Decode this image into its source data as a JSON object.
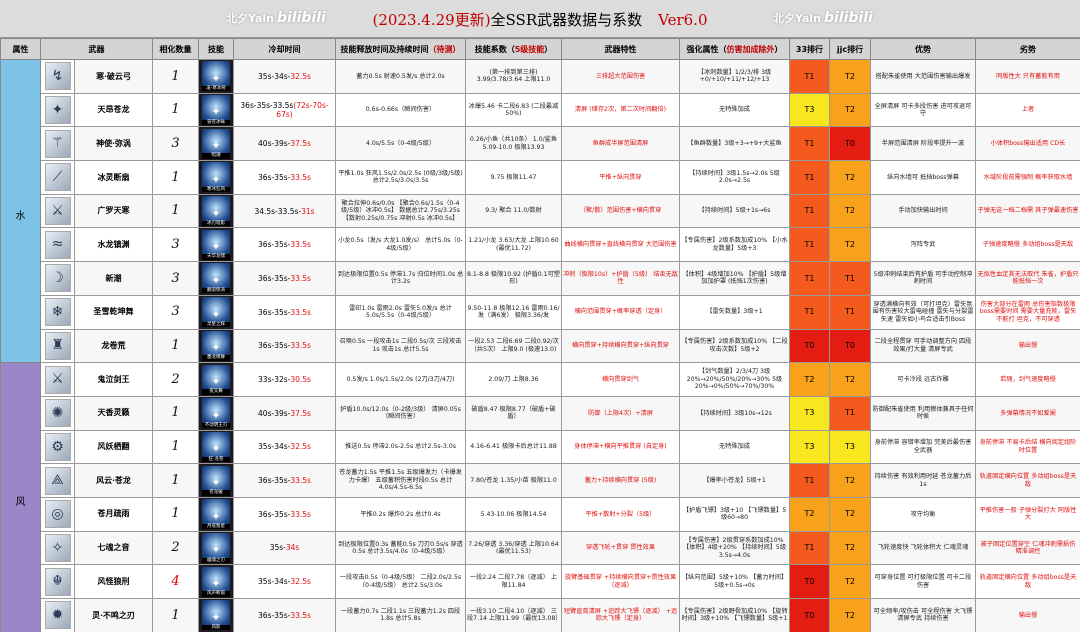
{
  "header": {
    "watermark_left": "北夕Yaln",
    "watermark_left_logo": "bilibili",
    "watermark_right": "北夕Yaln",
    "watermark_right_logo": "bilibili",
    "date": "(2023.4.29更新)",
    "title": "全SSR武器数据与系数",
    "version": "Ver6.0"
  },
  "columns": {
    "attr": "属性",
    "weapon": "武器",
    "count": "相化数量",
    "skill": "技能",
    "cooldown": "冷却时间",
    "release": "技能释放时间及持续时间",
    "release_note": "（待测）",
    "coef": "技能系数（",
    "coef_note": "5级技能",
    "coef_end": "）",
    "feature": "武器特性",
    "boost": "强化属性（",
    "boost_note": "仿害加成除外",
    "boost_end": "）",
    "r33": "33排行",
    "jjc": "jjc排行",
    "pros": "优势",
    "cons": "劣势"
  },
  "attributes": {
    "water": "水",
    "wind": "风"
  },
  "rows": [
    {
      "name": "寒·破云弓",
      "count": "1",
      "skill": "凌·寒冰射",
      "cd": "35s-34s-",
      "cd_hl": "32.5s",
      "release": "蓄力0.5s 射速0.5发/s 总计2.0s",
      "coef": "(第一排到第三排) 3.99/3.78/3.64 上限11.0",
      "feature": "三排超大范围伤害",
      "boost": "【冰刺数量】1/2/3/排 3级+0/+10/+11/+12/+13",
      "r33": "T1",
      "r33_cls": "t1",
      "jjc": "T2",
      "jjc_cls": "t2",
      "pros": "搭配朱雀使用 大范围伤害输出爆发",
      "cons": "同版性大 只有蓄能有用",
      "icon": "↯"
    },
    {
      "name": "天昂苍龙",
      "count": "1",
      "skill": "冒苍冰咏",
      "cd": "36s-35s-33.5s",
      "cd_hl": "(72s-70s-67s)",
      "release": "0.6s-0.66s（瞬间伤害）",
      "coef": "冰爆5.46 卡二段6.83 (二段最减50%)",
      "feature": "清屏 (储存2次，第二次时间翻倍)",
      "boost": "无特殊加成",
      "r33": "T3",
      "r33_cls": "t3",
      "jjc": "T2",
      "jjc_cls": "t2",
      "pros": "全屏清屏 可卡多段伤害 进可攻退可守",
      "cons": "上者",
      "icon": "✦"
    },
    {
      "name": "神使·弥涡",
      "count": "3",
      "skill": "暗潮",
      "cd": "40s-39s-",
      "cd_hl": "37.5s",
      "release": "4.0s/5.5s（0-4级/5级）",
      "coef": "0.26/小鱼（共10条） 1.0/鲨鱼 5.09-10.0 极限13.93",
      "feature": "鱼群成半屏范围清屏",
      "boost": "【鱼群数量】3级+3→+9+大鲨鱼",
      "r33": "T1",
      "r33_cls": "t1",
      "jjc": "T0",
      "jjc_cls": "t0",
      "pros": "半屏范围清屏 阶段率提升一波",
      "cons": "小体积boss输出适用 CD长",
      "icon": "⚚"
    },
    {
      "name": "冰灵断扇",
      "count": "1",
      "skill": "寒冰狂风",
      "cd": "36s-35s-",
      "cd_hl": "33.5s",
      "release": "平推1.0s 狂风1.5s/2.0s/2.5s (0级/3级/5级) 总计2.5s/3.0s/3.5s",
      "coef": "9.75 极限11.47",
      "feature": "平推+纵向贯穿",
      "boost": "【持续时间】3级1.5s→2.0s 5级2.0s→2.5s",
      "r33": "T1",
      "r33_cls": "t1",
      "jjc": "T2",
      "jjc_cls": "t2",
      "pros": "纵向水墙可 抵挡boss弹幕",
      "cons": "水域阶段前需强制 概率获取水墙",
      "icon": "⟋"
    },
    {
      "name": "广罗天寒",
      "count": "1",
      "skill": "冰刃暗影",
      "cd": "34.5s-33.5s-",
      "cd_hl": "31s",
      "release": "聚合拉伸0.6s/0.0s 【聚合0.6s/1.5s（0-4级/5级）冰冲0.5s】 数据总计2.75s/3.25s 【数射0.25s/0.75s 冲射0.5s 冰冲0.5s】",
      "coef": "9.3/ 聚合 11.0/数射",
      "feature": "（聚/散）范围伤害+横向贯穿",
      "boost": "【持续时间】5级+1s→6s",
      "r33": "T1",
      "r33_cls": "t1",
      "jjc": "T2",
      "jjc_cls": "t2",
      "pros": "手动加快输出时间",
      "cons": "子弹无这一档二档需 其子弹最速伤害",
      "icon": "⚔"
    },
    {
      "name": "水龙镇渊",
      "count": "3",
      "skill": "天华龙啸",
      "cd": "36s-35s-",
      "cd_hl": "33.5s",
      "release": "小龙0.5s（发/s 大龙1.0发/s） 总计5.0s（0-4级/5级）",
      "coef": "1.21/小龙 3.63/大龙 上限10.60 (最优11.72)",
      "feature": "曲线横向贯穿+直线横向贯穿 大范围伤害",
      "boost": "【专属伤害】2级系数加成10% 【小水龙数量】5级+3",
      "r33": "T1",
      "r33_cls": "t1",
      "jjc": "T2",
      "jjc_cls": "t2",
      "pros": "泻阵专武",
      "cons": "子弹速度略慢 多动组boss是天敌",
      "icon": "≈"
    },
    {
      "name": "新潮",
      "count": "3",
      "skill": "翻浪惊涛",
      "cd": "36s-35s-",
      "cd_hl": "33.5s",
      "release": "到达极限位置0.5s 停滞1.7s 归位时间1.0s 总计3.2s",
      "coef": "8.1-8.8 极限10.92 (护盾0.1可塑形)",
      "feature": "冲刺（极限10s）+护盾（5级） 结束无敌性",
      "boost": "【体积】4级增加10% 【护盾】5级增加加护罩 (抵挡1次伤害)",
      "r33": "T1",
      "r33_cls": "t1",
      "jjc": "T1",
      "jjc_cls": "t1",
      "pros": "5级冲刺结束后有护盾 可手动控制冲刺时间",
      "cons": "无拟性血定其无法取代 朱雀，护盾只能抵挡一次",
      "icon": "☽"
    },
    {
      "name": "圣雪乾坤舞",
      "count": "3",
      "skill": "灵星之辉",
      "cd": "36s-35s-",
      "cd_hl": "33.5s",
      "release": "雷印1.0s 雷雨2.0s 雷矢5.0发/s 总计5.0s/5.5s（0-4级/5级）",
      "coef": "9.50-11.8 极限12.16 雷雨0.16/发（满6发） 极限3.36/发",
      "feature": "横向范围贯穿+概率穿透（定身）",
      "boost": "【雷矢数量】3级+1",
      "r33": "T1",
      "r33_cls": "t1",
      "jjc": "T1",
      "jjc_cls": "t1",
      "pros": "穿透满横向有效（可打坦克）雷矢氛围有伤害较大雷电碰撞 雷矢与分裂雷矢速 雷矢如小鸟合适击引Boss",
      "cons": "伤害大部分在雷雨 总伤害指数极限boss需要时间 需要大量充能，雷矢不能打 坦克，不可穿透",
      "icon": "❄"
    },
    {
      "name": "龙卷荒",
      "count": "1",
      "skill": "墨龙缭舞",
      "cd": "36s-35s-",
      "cd_hl": "33.5s",
      "release": "召唤0.5s 一段攻击1s 二段0.5s/次 三段攻击1s 攻击1s 总计5.5s",
      "coef": "一段2.53 二段6.69 二段0.92/次（共5次） 上限9.0 (极速13.0)",
      "feature": "横向贯穿+持续横向贯穿+纵向贯穿",
      "boost": "【专属伤害】2级系数加成10% 【二段攻击次数】5级+2",
      "r33": "T0",
      "r33_cls": "t0",
      "jjc": "T0",
      "jjc_cls": "t0",
      "pros": "二段全程贯穿 可手动调整方向 四段效果/打大量 清屏专武",
      "cons": "输出慢",
      "icon": "♜"
    },
    {
      "name": "鬼泣剑王",
      "count": "2",
      "skill": "夜叉舞",
      "cd": "33s-32s-",
      "cd_hl": "30.5s",
      "release": "0.5发/s 1.0s/1.5s/2.0s (2刀/3刀/4刀)",
      "coef": "2.09/刀 上限8.36",
      "feature": "横向贯穿剑气",
      "boost": "【剑气数量】2/3/4刀 3级20%→20%/50%/20%→30% 5级20%→0%/50%→70%/30%",
      "r33": "T2",
      "r33_cls": "t2",
      "jjc": "T2",
      "jjc_cls": "t2",
      "pros": "可卡冷段 远古炸雕",
      "cons": "若随，剑气速度略慢",
      "icon": "⚔"
    },
    {
      "name": "天香灵籁",
      "count": "1",
      "skill": "不动明王刃",
      "cd": "40s-39s-",
      "cd_hl": "37.5s",
      "release": "护盾10.0s/12.0s（0-2级/3级） 清屏0.05s（瞬间伤害）",
      "coef": "破盾8.47 极限8.77（破盾+破盾）",
      "feature": "防御（上限4次）+清屏",
      "boost": "【持续时间】3级10s→12s",
      "r33": "T3",
      "r33_cls": "t3",
      "jjc": "T1",
      "jjc_cls": "t1",
      "pros": "防御配朱雀使用 利用擦体兼具于任何时侯",
      "cons": "多弹幕情况不如爱阑",
      "icon": "✺"
    },
    {
      "name": "风妖栖翻",
      "count": "1",
      "skill": "狂·龙卷",
      "cd": "35s-34s-",
      "cd_hl": "32.5s",
      "release": "推送0.5s 停滞2.0s-2.5s 总计2.5s-3.0s",
      "coef": "4.16-6.41 极限卡后总计11.88",
      "feature": "身体停滞+横向平推贯穿 (自定身)",
      "boost": "无特殊加成",
      "r33": "T3",
      "r33_cls": "t3",
      "jjc": "T3",
      "jjc_cls": "t3",
      "pros": "身前停滞 容错率增加 完美后最伤害全武器",
      "cons": "身前停滞 不易卡后结 横向阅定组阶时位置",
      "icon": "⚙"
    },
    {
      "name": "风云·苍龙",
      "count": "1",
      "skill": "苍龙破",
      "cd": "36s-35s-",
      "cd_hl": "33.5s",
      "release": "苍龙蓄力1.5s 平推1.5s 五级爆发力（卡爆发力卡爆） 五级蓄积伤害时段0.5s 总计4.0s/4.5s-6.5s",
      "coef": "7.80/苍龙 1.35/小苗 极限11.0",
      "feature": "蓄力+持续横向贯穿 (5级)",
      "boost": "【爆率小苍龙】5级+1",
      "r33": "T1",
      "r33_cls": "t1",
      "jjc": "T2",
      "jjc_cls": "t2",
      "pros": "持续伤害 有效利用时延 苍龙蓄力后1s",
      "cons": "轨道固定横向位置 多动组boss是天敌",
      "icon": "⟁"
    },
    {
      "name": "苍月疏雨",
      "count": "1",
      "skill": "月夜暂星",
      "cd": "36s-35s-",
      "cd_hl": "33.5s",
      "release": "平推0.2s 爆炸0.2s 总计0.4s",
      "coef": "5.43-10.06 极限14.54",
      "feature": "平推+散射+分裂（5级）",
      "boost": "【护盾飞镖】3级+10 【飞镖数量】5级60→80",
      "r33": "T2",
      "r33_cls": "t2",
      "jjc": "T2",
      "jjc_cls": "t2",
      "pros": "攻守均衡",
      "cons": "平推伤害一般 子弹分裂打大 同版性大",
      "icon": "◎"
    },
    {
      "name": "七魂之音",
      "count": "2",
      "skill": "幽魂之刃",
      "cd": "35s-",
      "cd_hl": "34s",
      "release": "到达极限位置0.3s 蓄能0.5s 刀刃0.5s/s 穿透0.5s 总计3.5s/4.0s（0-4级/5级）",
      "coef": "7.26/穿透 3.36/穿透 上限10.64 (最优11.53)",
      "feature": "穿透飞轮+贯穿 贯性效果",
      "boost": "【专属伤害】2级贯穿系数加成10% 【体积】4级+20% 【持续时间】5级3.5s→4.0s",
      "r33": "T1",
      "r33_cls": "t1",
      "jjc": "T2",
      "jjc_cls": "t2",
      "pros": "飞轮速度快 飞轮体积大 仁魂灵魂",
      "cons": "被子固定位置穿空 仁魂冲刺需损伤 精准调控",
      "icon": "✧"
    },
    {
      "name": "风怪狼刑",
      "count": "4",
      "skill": "风声断锁",
      "cd": "35s-34s-",
      "cd_hl": "32.5s",
      "release": "一段攻击0.5s（0-4级/5级） 二段2.0s/2.5s（0-4级/5级） 总计2.5s/3.0s",
      "coef": "一段2.24 二段7.78（逐减） 上限11.84",
      "feature": "旋臂基础贯穿 +持续横向贯穿+贯性效果（逐减）",
      "boost": "【纵向范围】5级+10% 【蓄力时间】5级+0.5s→0s",
      "r33": "T0",
      "r33_cls": "t0",
      "jjc": "T2",
      "jjc_cls": "t2",
      "pros": "可穿身位置 可打极限位置 可卡二段伤害",
      "cons": "轨道固定横向位置 多动组boss是天敌",
      "icon": "☬"
    },
    {
      "name": "灵·不鸣之刃",
      "count": "1",
      "skill": "风影",
      "cd": "36s-35s-",
      "cd_hl": "33.5s",
      "release": "一段蓄力0.7s 二段1.1s 三段蓄力1.2s 四段1.8s 总计5.8s",
      "coef": "一段3.10 二段4.10（逐减） 三段7.14 上限11.99（最优13.08）",
      "feature": "短臂直育清屏 +追踪大飞镖（逐减） +追踪大飞镖（定身）",
      "boost": "【专属伤害】2级野骨加成10% 【旋转时间】3级+10% 【飞镖数量】5级+1",
      "r33": "T0",
      "r33_cls": "t0",
      "jjc": "T2",
      "jjc_cls": "t2",
      "pros": "可全频率/攻伤击 可全程伤害 大飞镖清屏专武 持续伤害",
      "cons": "输出慢",
      "icon": "✹"
    }
  ]
}
